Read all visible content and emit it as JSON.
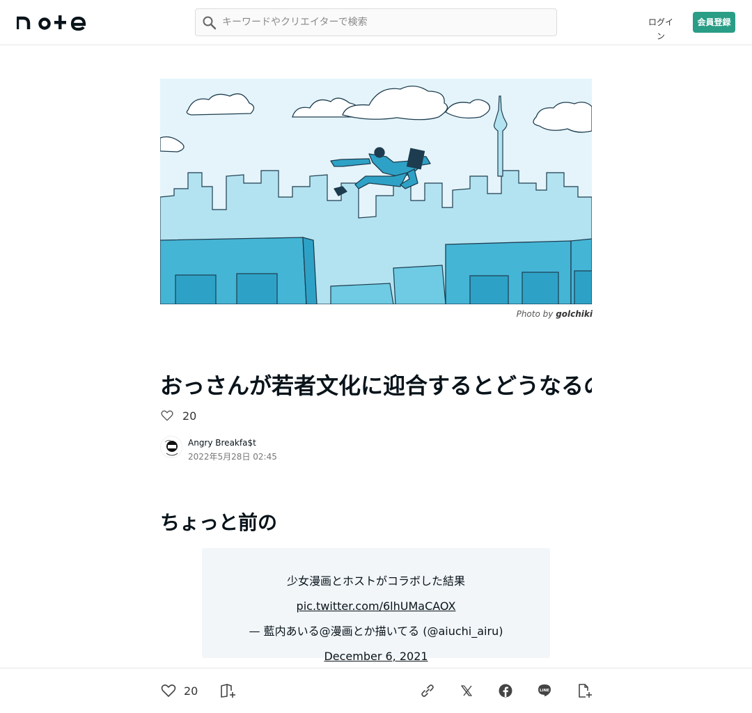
{
  "header": {
    "logo": "note",
    "search_placeholder": "キーワードやクリエイターで検索",
    "login_label": "ログイン",
    "signup_label": "会員登録"
  },
  "hero": {
    "credit_prefix": "Photo by",
    "credit_author": "golchiki"
  },
  "article": {
    "title": "おっさんが若者文化に迎合するとどうなるのかがよくわかるやつ",
    "like_count": "20",
    "author_name": "Angry Breakfa$t",
    "date": "2022年5月28日 02:45",
    "section_heading": "ちょっと前の",
    "embed": {
      "text": "少女漫画とホストがコラボした結果 ",
      "link": "pic.twitter.com/6lhUMaCAOX",
      "attribution": "— 藍内あいる@漫画とか描いてる (@aiuchi_airu) ",
      "date_link": "December 6, 2021"
    }
  },
  "bottom_bar": {
    "like_count": "20"
  },
  "colors": {
    "brand": "#2a9d86",
    "sky": "#e4f4fa",
    "building_light": "#b3e3f0",
    "building_dark": "#45b5d6"
  }
}
